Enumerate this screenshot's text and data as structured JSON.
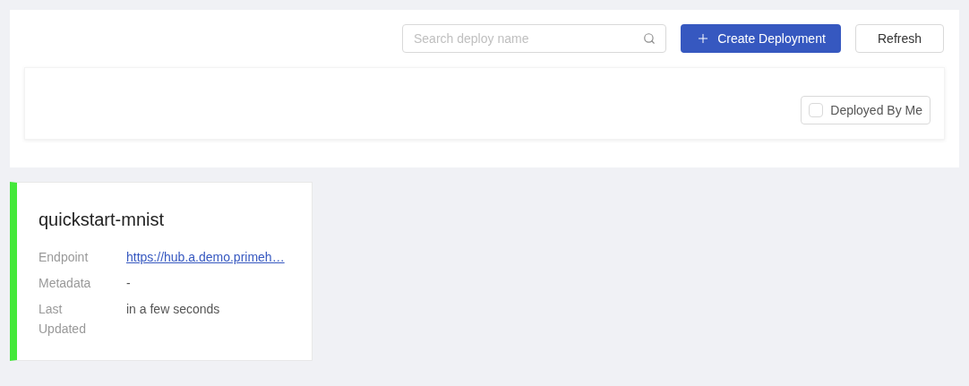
{
  "search": {
    "placeholder": "Search deploy name"
  },
  "buttons": {
    "create": "Create Deployment",
    "refresh": "Refresh"
  },
  "filter": {
    "label": "Deployed By Me",
    "checked": false
  },
  "deployments": [
    {
      "name": "quickstart-mnist",
      "color": "#44e83a",
      "fields": [
        {
          "label": "Endpoint",
          "value": "https://hub.a.demo.primeh…",
          "kind": "link"
        },
        {
          "label": "Metadata",
          "value": "-",
          "kind": "text"
        },
        {
          "label": "Last Updated",
          "value": "in a few seconds",
          "kind": "text"
        }
      ]
    }
  ]
}
